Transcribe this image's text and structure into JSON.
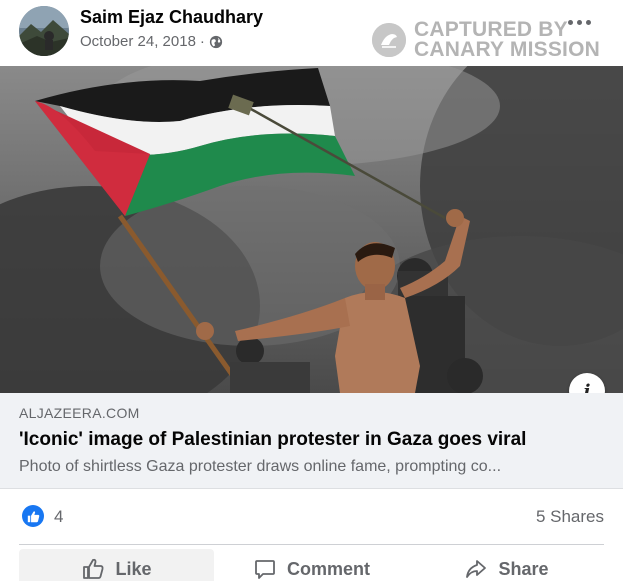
{
  "post": {
    "author": "Saim Ejaz Chaudhary",
    "date": "October 24, 2018",
    "separator": "·",
    "privacy_icon": "globe-icon",
    "watermark": [
      "CAPTURED BY",
      "CANARY MISSION"
    ],
    "more_icon": "more-options-icon"
  },
  "link_preview": {
    "domain": "ALJAZEERA.COM",
    "headline": "'Iconic' image of Palestinian protester in Gaza goes viral",
    "summary": "Photo of shirtless Gaza protester draws online fame, prompting co..."
  },
  "stats": {
    "reaction_icon": "like-icon",
    "reaction_count": "4",
    "shares": "5 Shares"
  },
  "actions": {
    "like": "Like",
    "comment": "Comment",
    "share": "Share"
  },
  "colors": {
    "accent": "#1877f2",
    "muted": "#65676b",
    "preview_bg": "#f0f2f5"
  }
}
